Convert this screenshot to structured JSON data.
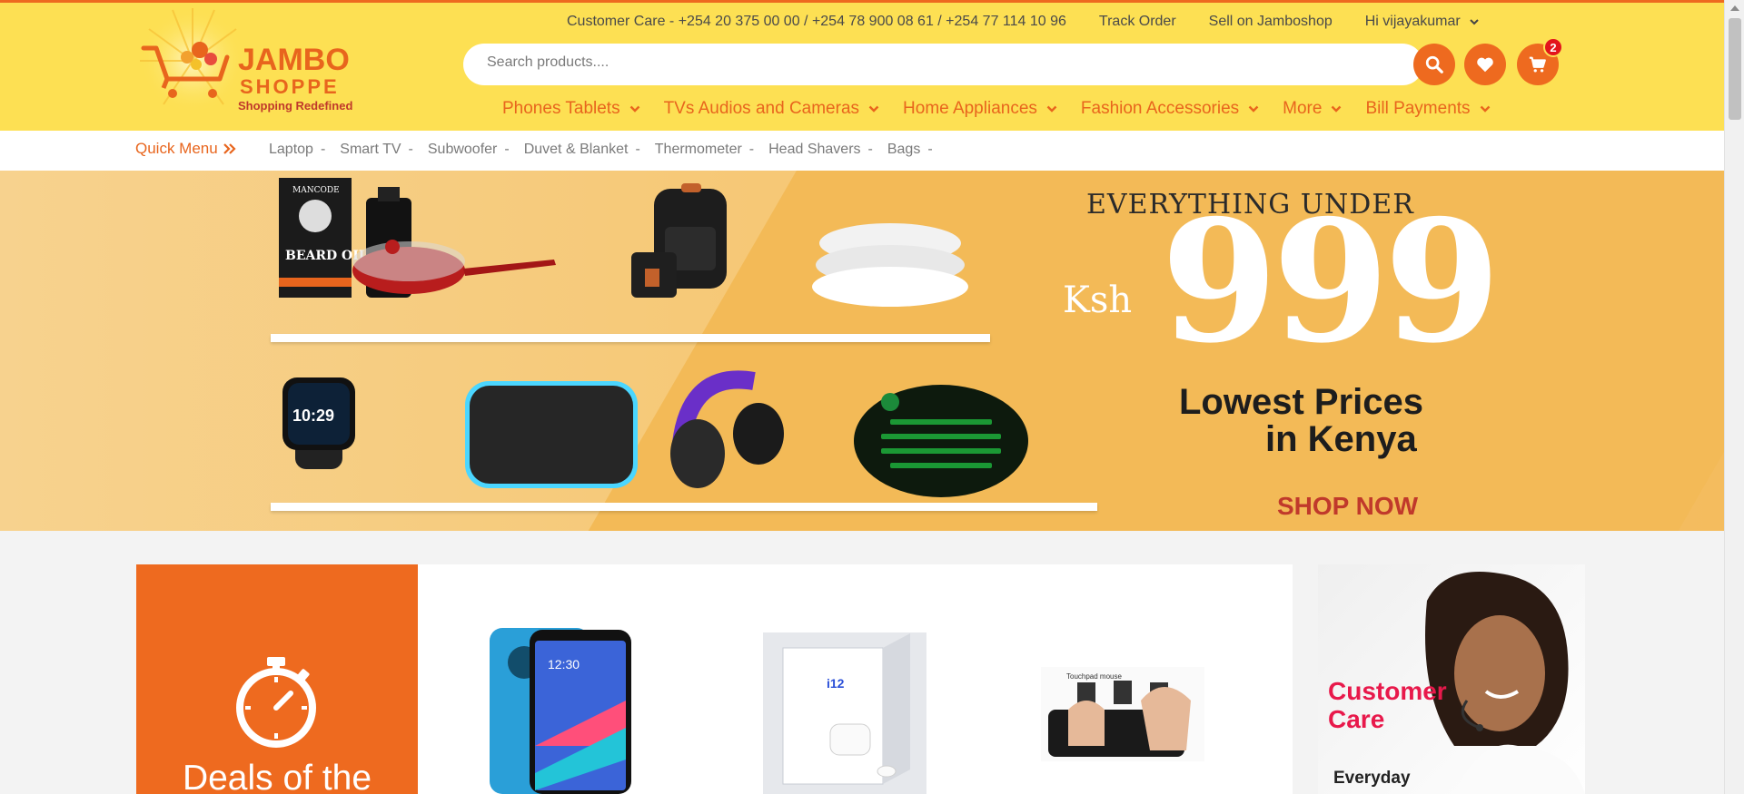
{
  "brand": {
    "name_line1": "JAMBO",
    "name_line2": "SHOPPE",
    "tagline": "Shopping Redefined"
  },
  "topbar": {
    "customer_care": "Customer Care - +254 20 375 00 00 / +254 78 900 08 61 / +254 77 114 10 96",
    "track_order": "Track Order",
    "sell": "Sell on Jamboshop",
    "user_greeting": "Hi vijayakumar"
  },
  "search": {
    "placeholder": "Search products...."
  },
  "cart": {
    "count": "2"
  },
  "mainnav": [
    {
      "label": "Phones Tablets"
    },
    {
      "label": "TVs Audios and Cameras"
    },
    {
      "label": "Home Appliances"
    },
    {
      "label": "Fashion Accessories"
    },
    {
      "label": "More"
    },
    {
      "label": "Bill Payments"
    }
  ],
  "quick_menu": {
    "label": "Quick Menu",
    "links": [
      "Laptop",
      "Smart TV",
      "Subwoofer",
      "Duvet & Blanket",
      "Thermometer",
      "Head Shavers",
      "Bags"
    ]
  },
  "banner": {
    "headline": "EVERYTHING UNDER",
    "currency": "Ksh",
    "price": "999",
    "sub_line1": "Lowest Prices",
    "sub_line2": "in Kenya",
    "cta": "SHOP NOW",
    "product_labels": {
      "beard_box": "BEARD OIL",
      "brand_small": "MANCODE",
      "watch_time": "10:29"
    }
  },
  "deals": {
    "title": "Deals of the"
  },
  "products": {
    "phone_time": "12:30",
    "earbuds_label": "i12",
    "keyboard_label": "Touchpad mouse"
  },
  "customer_care_card": {
    "title_line1": "Customer",
    "title_line2": "Care",
    "subtitle": "Everyday"
  },
  "colors": {
    "accent": "#ee6a1f",
    "header_bg": "#fde053",
    "badge": "#e3141c",
    "care_title": "#e8194b"
  }
}
